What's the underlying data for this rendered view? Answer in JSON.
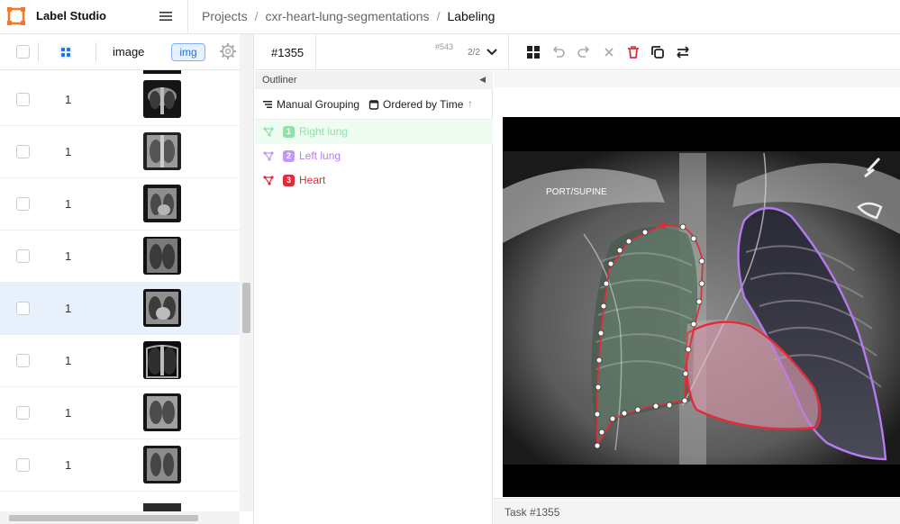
{
  "app": {
    "title": "Label Studio"
  },
  "breadcrumb": {
    "items": [
      "Projects",
      "cxr-heart-lung-segmentations",
      "Labeling"
    ],
    "separator": "/"
  },
  "data_table": {
    "columns": {
      "image_label": "image",
      "type_badge": "img"
    },
    "rows": [
      {
        "value": "1",
        "selected": false
      },
      {
        "value": "1",
        "selected": false
      },
      {
        "value": "1",
        "selected": false
      },
      {
        "value": "1",
        "selected": false
      },
      {
        "value": "1",
        "selected": true
      },
      {
        "value": "1",
        "selected": false
      },
      {
        "value": "1",
        "selected": false
      },
      {
        "value": "1",
        "selected": false
      }
    ]
  },
  "toolbar": {
    "task_id": "#1355",
    "annotation_id": "#543",
    "annotation_count": "2/2",
    "tools": [
      "grid-icon",
      "undo-icon",
      "redo-icon",
      "reset-icon",
      "delete-icon",
      "duplicate-icon",
      "swap-icon"
    ]
  },
  "outliner": {
    "title": "Outliner",
    "grouping_label": "Manual Grouping",
    "ordering_label": "Ordered by Time",
    "regions": [
      {
        "index": "1",
        "label": "Right lung",
        "color": "#8fe3a8",
        "active": true
      },
      {
        "index": "2",
        "label": "Left lung",
        "color": "#c19bf3",
        "active": false
      },
      {
        "index": "3",
        "label": "Heart",
        "color": "#e02d3c",
        "active": false
      }
    ]
  },
  "image_view": {
    "overlay_text": "PORT/SUPINE",
    "footer_task": "Task #1355"
  },
  "colors": {
    "accent": "#1a73e8",
    "logo": "#f5782a",
    "heart": "#e02d3c",
    "left_lung": "#b57cf0",
    "right_lung": "#e02d3c"
  }
}
